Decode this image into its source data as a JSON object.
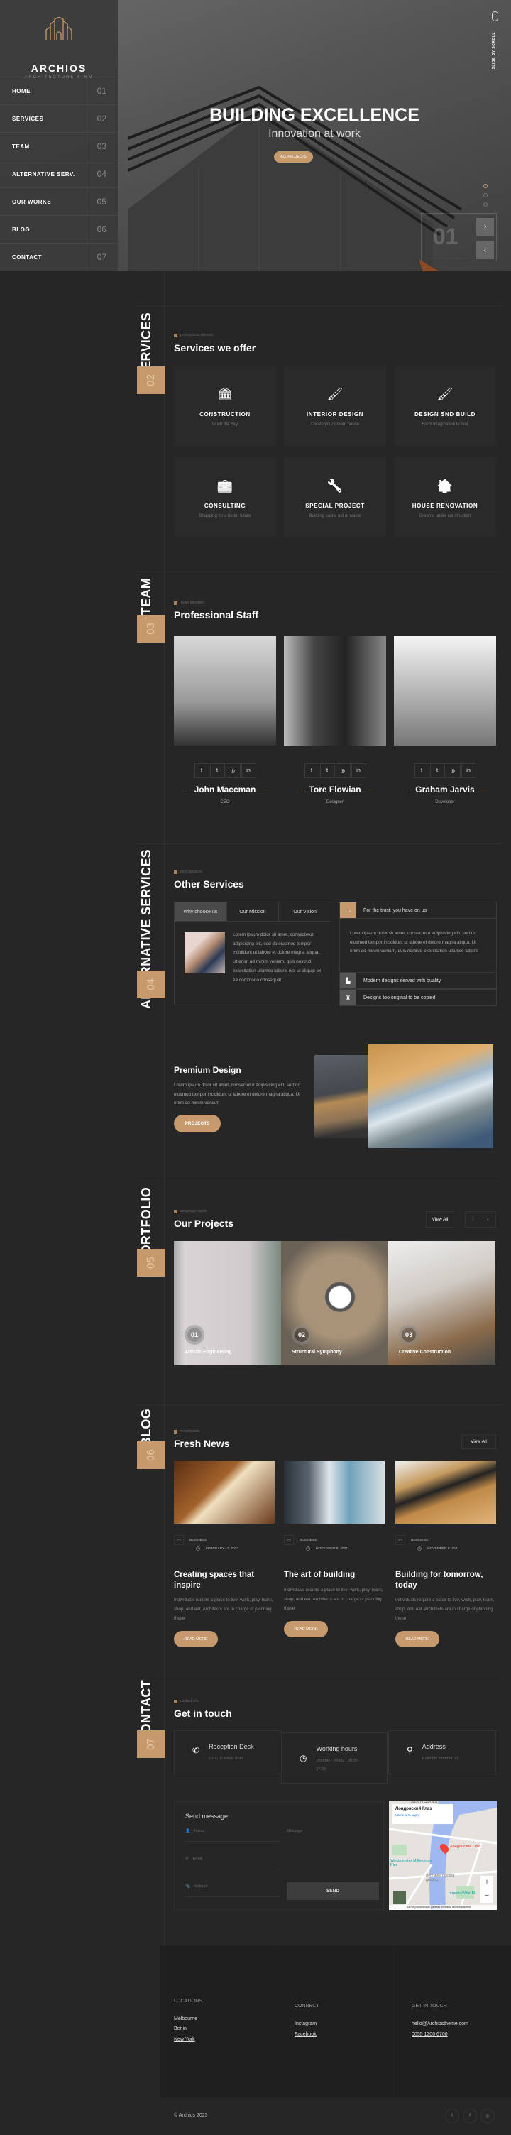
{
  "colors": {
    "accent": "#c69a6d",
    "background": "#262626",
    "sidebar": "#3a3a3a",
    "footer": "#1f1f1f"
  },
  "brand": {
    "name": "ARCHIOS",
    "tagline": "ARCHITECTURE FIRM",
    "logo_icon": "building-arches-icon"
  },
  "nav": [
    {
      "label": "HOME",
      "num": "01"
    },
    {
      "label": "SERVICES",
      "num": "02"
    },
    {
      "label": "TEAM",
      "num": "03"
    },
    {
      "label": "ALTERNATIVE SERV.",
      "num": "04"
    },
    {
      "label": "OUR WORKS",
      "num": "05"
    },
    {
      "label": "BLOG",
      "num": "06"
    },
    {
      "label": "CONTACT",
      "num": "07"
    }
  ],
  "hero": {
    "title": "BUILDING EXCELLENCE",
    "subtitle": "Innovation at work",
    "button": "ALL PROJECTS",
    "scroll_label": "SLIDE BY SCROLL",
    "slide_number": "01",
    "slide_count": 3,
    "active_slide": 1
  },
  "services": {
    "side_label": "SERVICES",
    "num": "02",
    "kicker": "professional services",
    "title": "Services we offer",
    "items": [
      {
        "icon": "bank-icon",
        "glyph": "🏛",
        "title": "CONSTRUCTION",
        "desc": "touch the Sky"
      },
      {
        "icon": "paint-brush-icon",
        "glyph": "🖌",
        "title": "INTERIOR DESIGN",
        "desc": "Create your dream house"
      },
      {
        "icon": "paint-roller-icon",
        "glyph": "🖌",
        "title": "DESIGN SND BUILD",
        "desc": "From imagination to real"
      },
      {
        "icon": "briefcase-icon",
        "glyph": "💼",
        "title": "CONSULTING",
        "desc": "Shapping for a better future"
      },
      {
        "icon": "wrench-icon",
        "glyph": "🔧",
        "title": "SPECIAL PROJECT",
        "desc": "Building castle out of waste"
      },
      {
        "icon": "house-laptop-icon",
        "glyph": "🏠",
        "title": "HOUSE RENOVATION",
        "desc": "Dreams under construction"
      }
    ]
  },
  "team": {
    "side_label": "TEAM",
    "num": "03",
    "kicker": "Team Members",
    "title": "Professional Staff",
    "members": [
      {
        "name": "John Maccman",
        "role": "CEO"
      },
      {
        "name": "Tore Flowian",
        "role": "Designer"
      },
      {
        "name": "Graham Jarvis",
        "role": "Developer"
      }
    ],
    "social": [
      "f",
      "t",
      "ig",
      "in"
    ]
  },
  "alt": {
    "side_label": "ALTERNATIVE SERVICES",
    "num": "04",
    "kicker": "more services",
    "title": "Other Services",
    "tabs": [
      "Why choose us",
      "Our Mission",
      "Our Vision"
    ],
    "tab_text": "Lorem ipsum dolor sit amet, consectetur adipisicing elit, sed do eiusmod tempor incididunt ut labore et dolore magna aliqua. Ut enim ad minim veniam, quis nostrud exercitation ullamco laboris nisi ut aliquip ex ea commodo consequat",
    "accordion": [
      {
        "title": "For the trust, you have on us",
        "body": "Lorem ipsum dolor sit amet, consectetur adipisicing elit, sed do eiusmod tempor incididunt ut labore et dolore magna aliqua. Ut enim ad minim veniam, quis nostrud exercitation ullamco laboris"
      },
      {
        "title": "Modern designs served with quality"
      },
      {
        "title": "Designs too original to be copied"
      }
    ]
  },
  "premium": {
    "title": "Premium Design",
    "text": "Lorem ipsum dolor sit amet, consectetur adipisicing elit, sed do eiusmod tempor incididunt ut labore et dolore magna aliqua. Ut enim ad minim veniam",
    "button": "PROJECTS"
  },
  "portfolio": {
    "side_label": "PORTFOLIO",
    "num": "05",
    "kicker": "amazing projects",
    "title": "Our Projects",
    "view_all": "View All",
    "projects": [
      {
        "num": "01",
        "title": "Artistic Engineering"
      },
      {
        "num": "02",
        "title": "Structural Symphony"
      },
      {
        "num": "03",
        "title": "Creative Construction"
      }
    ]
  },
  "blog": {
    "side_label": "BLOG",
    "num": "06",
    "kicker": "recent posts",
    "title": "Fresh News",
    "view_all": "View All",
    "posts": [
      {
        "category": "BUSINESS",
        "date": "FEBRUARY 12, 2023",
        "title": "Creating spaces that inspire",
        "text": "Individuals require a place to live, work, play, learn, shop, and eat. Architects are in charge of planning these",
        "button": "READ MORE"
      },
      {
        "category": "BUSINESS",
        "date": "NOVEMBER 8, 2021",
        "title": "The art of building",
        "text": "Individuals require a place to live, work, play, learn, shop, and eat. Architects are in charge of planning these",
        "button": "READ MORE"
      },
      {
        "category": "BUSINESS",
        "date": "NOVEMBER 8, 2021",
        "title": "Building for tomorrow, today",
        "text": "Individuals require a place to live, work, play, learn, shop, and eat. Architects are in charge of planning these",
        "button": "READ MORE"
      }
    ]
  },
  "contact": {
    "side_label": "CONTACT",
    "num": "07",
    "kicker": "contact info",
    "title": "Get in touch",
    "info": [
      {
        "icon": "phone-icon",
        "glyph": "✆",
        "title": "Reception Desk",
        "value": "(+01) 123 456 7890"
      },
      {
        "icon": "clock-icon",
        "glyph": "◷",
        "title": "Working hours",
        "value": "Monday - Friday / 08:00-17:00"
      },
      {
        "icon": "map-pin-icon",
        "glyph": "⚲",
        "title": "Address",
        "value": "Example street nr 23"
      }
    ],
    "form": {
      "title": "Send message",
      "name": "Name",
      "email": "Email",
      "subject": "Subject",
      "message": "Message",
      "send": "SEND"
    },
    "map": {
      "place": "Лондонский Глаз",
      "enlarge": "Увеличить карту",
      "pin_label": "Лондонский Глаз",
      "labels": [
        "COVENT GARDEN",
        "Westminster Millennium Pier",
        "Вестминстерский дворец",
        "Imperial War M"
      ],
      "attribution": "Картографические данные   Условия использования"
    }
  },
  "footer": {
    "locations_title": "LOCATIONS",
    "locations": [
      "Melbourne",
      "Berlin",
      "New York"
    ],
    "connect_title": "CONNECT",
    "connect": [
      "Instagram",
      "Facebook"
    ],
    "touch_title": "GET IN TOUCH",
    "touch": [
      "hello@Archiostheme.com",
      "0055 1200 6700"
    ],
    "copyright": "© Archios 2023",
    "social": [
      "twitter",
      "facebook",
      "instagram"
    ]
  }
}
